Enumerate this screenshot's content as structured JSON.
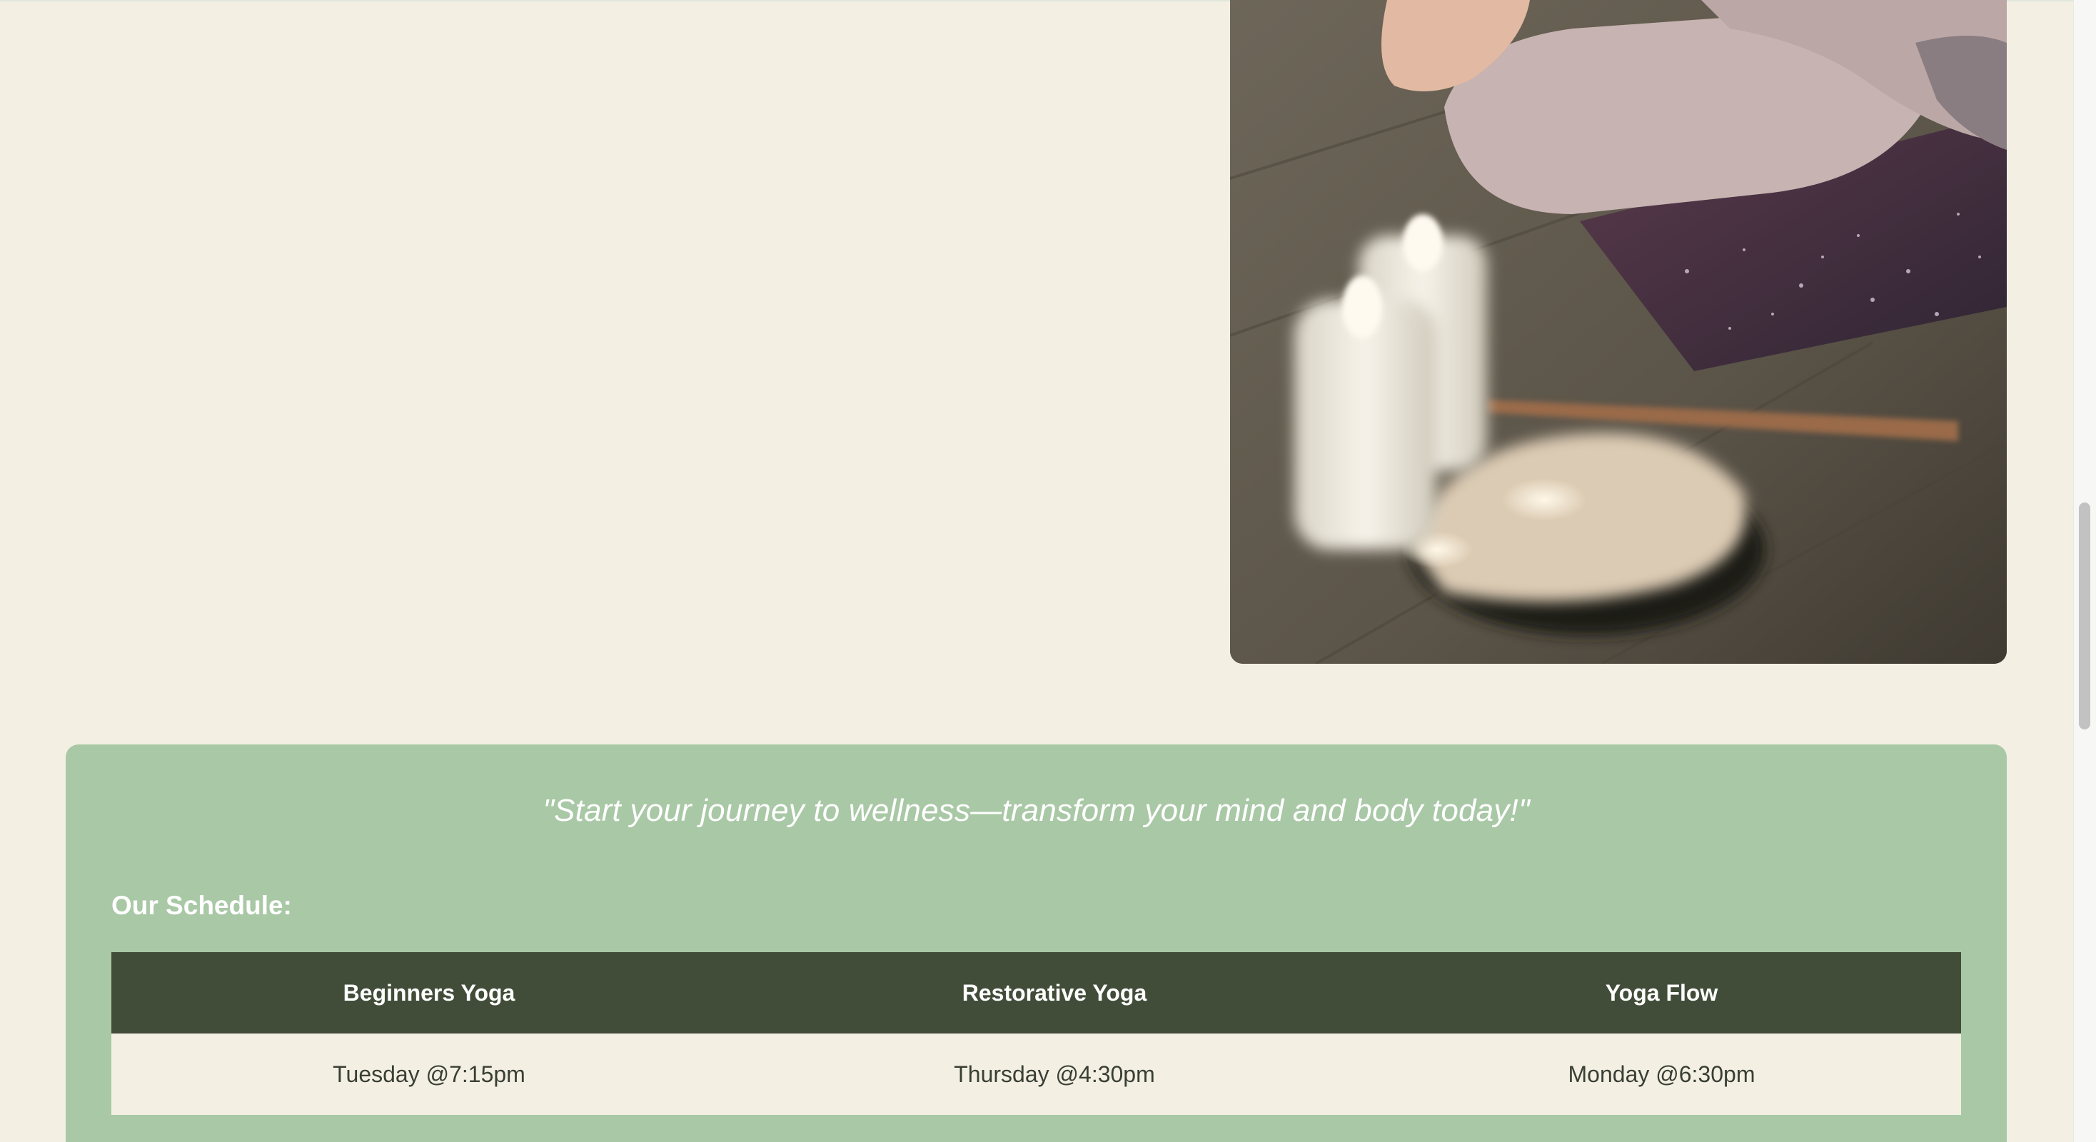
{
  "colors": {
    "background": "#f3f0e3",
    "promo_background": "#a9c8a6",
    "table_header": "#424d39",
    "table_body": "#f3f0e3"
  },
  "hero": {
    "image": "yoga-meditation-candles-photo"
  },
  "promo": {
    "quote": "\"Start your journey to wellness—transform your mind and body today!\"",
    "schedule_title": "Our Schedule:",
    "table": {
      "headers": [
        "Beginners Yoga",
        "Restorative Yoga",
        "Yoga Flow"
      ],
      "rows": [
        [
          "Tuesday @7:15pm",
          "Thursday @4:30pm",
          "Monday @6:30pm"
        ]
      ]
    }
  }
}
